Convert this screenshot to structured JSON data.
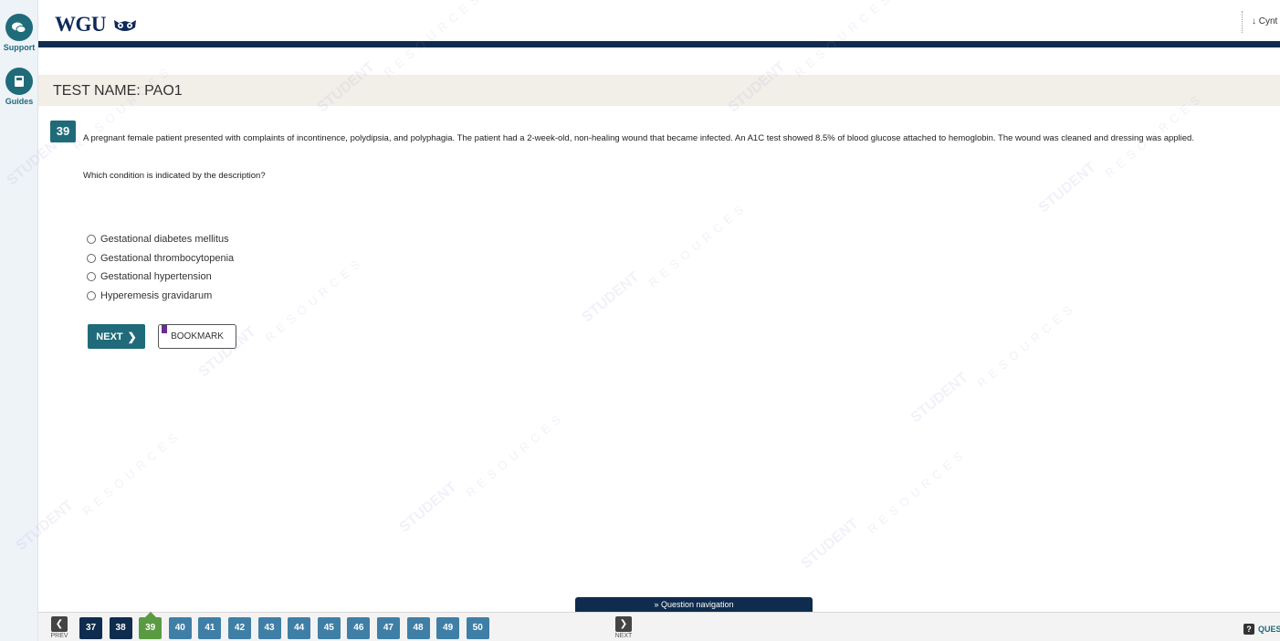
{
  "sidebar": {
    "items": [
      {
        "label": "Support",
        "icon": "chat-bubble-icon"
      },
      {
        "label": "Guides",
        "icon": "book-icon"
      }
    ]
  },
  "header": {
    "logo": "WGU",
    "user_name": "↓ Cynt"
  },
  "test": {
    "name": "TEST NAME:  PAO1"
  },
  "question": {
    "number": "39",
    "text": "A pregnant female patient presented with complaints of incontinence, polydipsia, and polyphagia. The patient had a 2-week-old, non-healing wound that became infected. An A1C test showed 8.5% of blood glucose attached to hemoglobin. The wound was cleaned and dressing was applied.",
    "prompt": "Which condition is indicated by the description?",
    "answers": [
      "Gestational diabetes mellitus",
      "Gestational thrombocytopenia",
      "Gestational hypertension",
      "Hyperemesis gravidarum"
    ]
  },
  "actions": {
    "next_label": "NEXT",
    "bookmark_label": "BOOKMARK"
  },
  "navigation": {
    "tab_label": "» Question navigation",
    "prev_label": "PREV",
    "next_label": "NEXT",
    "pages": [
      "37",
      "38",
      "39",
      "40",
      "41",
      "42",
      "43",
      "44",
      "45",
      "46",
      "47",
      "48",
      "49",
      "50"
    ],
    "current": "39",
    "help_label": "QUES"
  },
  "watermark": {
    "main": "STUDENT",
    "sub": "RESOURCES"
  },
  "colors": {
    "teal": "#1f6b7a",
    "navy": "#0f2c4e",
    "current_page": "#5a9b42",
    "pending_page": "#3f7fa6",
    "bookmark_flag": "#6b2c8f"
  }
}
